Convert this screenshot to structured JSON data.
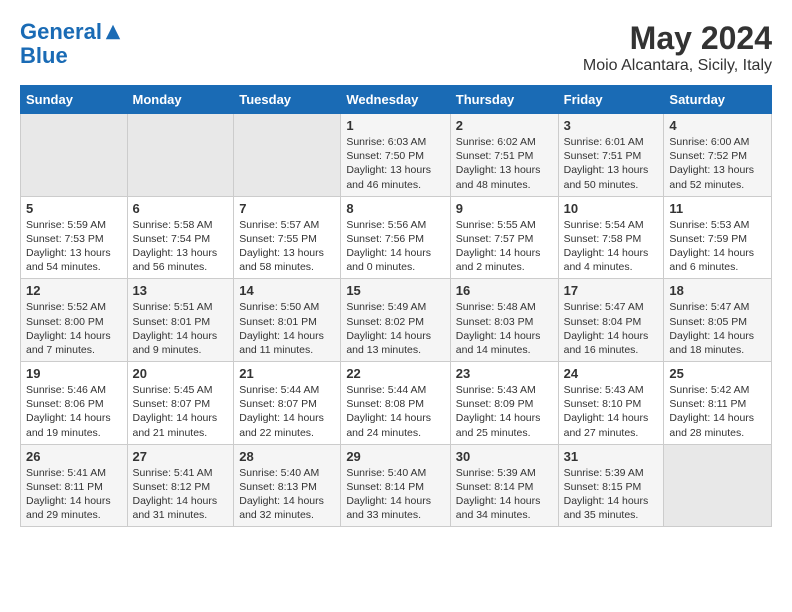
{
  "logo": {
    "line1": "General",
    "line2": "Blue"
  },
  "title": "May 2024",
  "subtitle": "Moio Alcantara, Sicily, Italy",
  "days_of_week": [
    "Sunday",
    "Monday",
    "Tuesday",
    "Wednesday",
    "Thursday",
    "Friday",
    "Saturday"
  ],
  "weeks": [
    [
      {
        "day": "",
        "info": ""
      },
      {
        "day": "",
        "info": ""
      },
      {
        "day": "",
        "info": ""
      },
      {
        "day": "1",
        "info": "Sunrise: 6:03 AM\nSunset: 7:50 PM\nDaylight: 13 hours\nand 46 minutes."
      },
      {
        "day": "2",
        "info": "Sunrise: 6:02 AM\nSunset: 7:51 PM\nDaylight: 13 hours\nand 48 minutes."
      },
      {
        "day": "3",
        "info": "Sunrise: 6:01 AM\nSunset: 7:51 PM\nDaylight: 13 hours\nand 50 minutes."
      },
      {
        "day": "4",
        "info": "Sunrise: 6:00 AM\nSunset: 7:52 PM\nDaylight: 13 hours\nand 52 minutes."
      }
    ],
    [
      {
        "day": "5",
        "info": "Sunrise: 5:59 AM\nSunset: 7:53 PM\nDaylight: 13 hours\nand 54 minutes."
      },
      {
        "day": "6",
        "info": "Sunrise: 5:58 AM\nSunset: 7:54 PM\nDaylight: 13 hours\nand 56 minutes."
      },
      {
        "day": "7",
        "info": "Sunrise: 5:57 AM\nSunset: 7:55 PM\nDaylight: 13 hours\nand 58 minutes."
      },
      {
        "day": "8",
        "info": "Sunrise: 5:56 AM\nSunset: 7:56 PM\nDaylight: 14 hours\nand 0 minutes."
      },
      {
        "day": "9",
        "info": "Sunrise: 5:55 AM\nSunset: 7:57 PM\nDaylight: 14 hours\nand 2 minutes."
      },
      {
        "day": "10",
        "info": "Sunrise: 5:54 AM\nSunset: 7:58 PM\nDaylight: 14 hours\nand 4 minutes."
      },
      {
        "day": "11",
        "info": "Sunrise: 5:53 AM\nSunset: 7:59 PM\nDaylight: 14 hours\nand 6 minutes."
      }
    ],
    [
      {
        "day": "12",
        "info": "Sunrise: 5:52 AM\nSunset: 8:00 PM\nDaylight: 14 hours\nand 7 minutes."
      },
      {
        "day": "13",
        "info": "Sunrise: 5:51 AM\nSunset: 8:01 PM\nDaylight: 14 hours\nand 9 minutes."
      },
      {
        "day": "14",
        "info": "Sunrise: 5:50 AM\nSunset: 8:01 PM\nDaylight: 14 hours\nand 11 minutes."
      },
      {
        "day": "15",
        "info": "Sunrise: 5:49 AM\nSunset: 8:02 PM\nDaylight: 14 hours\nand 13 minutes."
      },
      {
        "day": "16",
        "info": "Sunrise: 5:48 AM\nSunset: 8:03 PM\nDaylight: 14 hours\nand 14 minutes."
      },
      {
        "day": "17",
        "info": "Sunrise: 5:47 AM\nSunset: 8:04 PM\nDaylight: 14 hours\nand 16 minutes."
      },
      {
        "day": "18",
        "info": "Sunrise: 5:47 AM\nSunset: 8:05 PM\nDaylight: 14 hours\nand 18 minutes."
      }
    ],
    [
      {
        "day": "19",
        "info": "Sunrise: 5:46 AM\nSunset: 8:06 PM\nDaylight: 14 hours\nand 19 minutes."
      },
      {
        "day": "20",
        "info": "Sunrise: 5:45 AM\nSunset: 8:07 PM\nDaylight: 14 hours\nand 21 minutes."
      },
      {
        "day": "21",
        "info": "Sunrise: 5:44 AM\nSunset: 8:07 PM\nDaylight: 14 hours\nand 22 minutes."
      },
      {
        "day": "22",
        "info": "Sunrise: 5:44 AM\nSunset: 8:08 PM\nDaylight: 14 hours\nand 24 minutes."
      },
      {
        "day": "23",
        "info": "Sunrise: 5:43 AM\nSunset: 8:09 PM\nDaylight: 14 hours\nand 25 minutes."
      },
      {
        "day": "24",
        "info": "Sunrise: 5:43 AM\nSunset: 8:10 PM\nDaylight: 14 hours\nand 27 minutes."
      },
      {
        "day": "25",
        "info": "Sunrise: 5:42 AM\nSunset: 8:11 PM\nDaylight: 14 hours\nand 28 minutes."
      }
    ],
    [
      {
        "day": "26",
        "info": "Sunrise: 5:41 AM\nSunset: 8:11 PM\nDaylight: 14 hours\nand 29 minutes."
      },
      {
        "day": "27",
        "info": "Sunrise: 5:41 AM\nSunset: 8:12 PM\nDaylight: 14 hours\nand 31 minutes."
      },
      {
        "day": "28",
        "info": "Sunrise: 5:40 AM\nSunset: 8:13 PM\nDaylight: 14 hours\nand 32 minutes."
      },
      {
        "day": "29",
        "info": "Sunrise: 5:40 AM\nSunset: 8:14 PM\nDaylight: 14 hours\nand 33 minutes."
      },
      {
        "day": "30",
        "info": "Sunrise: 5:39 AM\nSunset: 8:14 PM\nDaylight: 14 hours\nand 34 minutes."
      },
      {
        "day": "31",
        "info": "Sunrise: 5:39 AM\nSunset: 8:15 PM\nDaylight: 14 hours\nand 35 minutes."
      },
      {
        "day": "",
        "info": ""
      }
    ]
  ]
}
